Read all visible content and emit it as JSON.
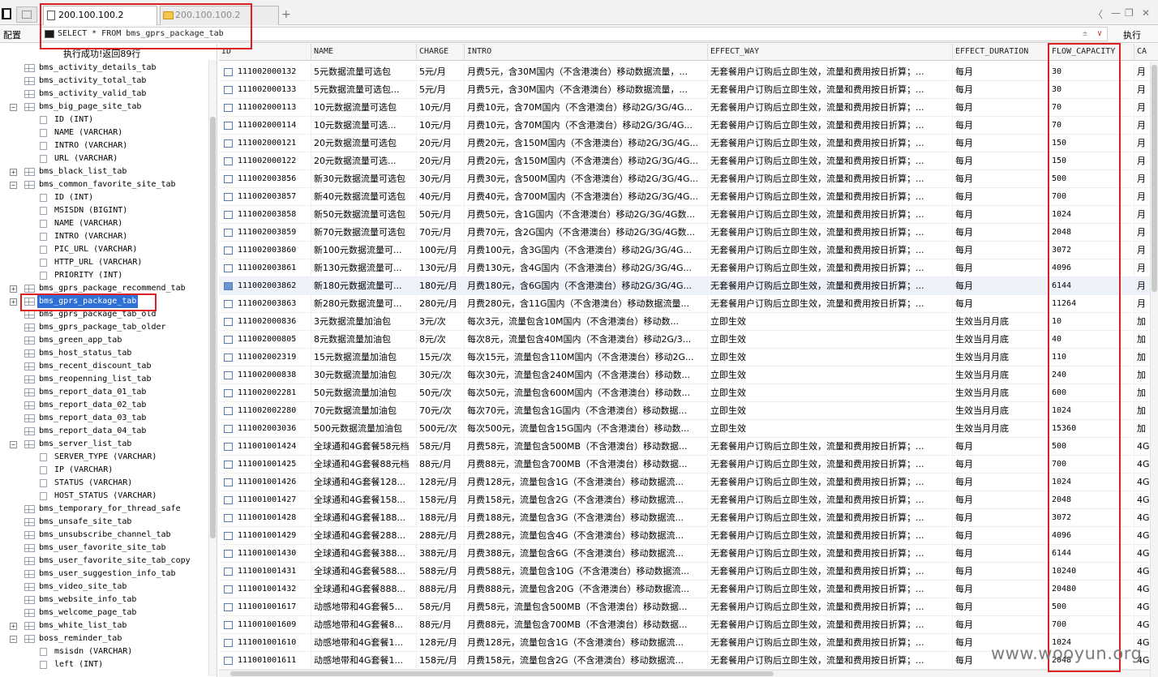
{
  "tabs": [
    {
      "label": "200.100.100.2",
      "active": true
    },
    {
      "label": "200.100.100.2",
      "active": false
    }
  ],
  "toolbar": {
    "config_label": "配置",
    "sql": "SELECT * FROM bms_gprs_package_tab",
    "execute_label": "执行",
    "sql_controls": [
      "±",
      "∨"
    ]
  },
  "window_controls": [
    "〈",
    "—",
    "❐",
    "✕"
  ],
  "plus_label": "+",
  "status_message": "执行成功!返回89行",
  "tree": [
    {
      "kind": "table",
      "label": "bms_activity_details_tab",
      "toggle": ""
    },
    {
      "kind": "table",
      "label": "bms_activity_total_tab",
      "toggle": ""
    },
    {
      "kind": "table",
      "label": "bms_activity_valid_tab",
      "toggle": ""
    },
    {
      "kind": "table",
      "label": "bms_big_page_site_tab",
      "toggle": "−"
    },
    {
      "kind": "column",
      "label": "ID (INT)"
    },
    {
      "kind": "column",
      "label": "NAME (VARCHAR)"
    },
    {
      "kind": "column",
      "label": "INTRO (VARCHAR)"
    },
    {
      "kind": "column",
      "label": "URL (VARCHAR)"
    },
    {
      "kind": "table",
      "label": "bms_black_list_tab",
      "toggle": "+"
    },
    {
      "kind": "table",
      "label": "bms_common_favorite_site_tab",
      "toggle": "−"
    },
    {
      "kind": "column",
      "label": "ID (INT)"
    },
    {
      "kind": "column",
      "label": "MSISDN (BIGINT)"
    },
    {
      "kind": "column",
      "label": "NAME (VARCHAR)"
    },
    {
      "kind": "column",
      "label": "INTRO (VARCHAR)"
    },
    {
      "kind": "column",
      "label": "PIC_URL (VARCHAR)"
    },
    {
      "kind": "column",
      "label": "HTTP_URL (VARCHAR)"
    },
    {
      "kind": "column",
      "label": "PRIORITY (INT)"
    },
    {
      "kind": "table",
      "label": "bms_gprs_package_recommend_tab",
      "toggle": "+"
    },
    {
      "kind": "table",
      "label": "bms_gprs_package_tab",
      "toggle": "+",
      "selected": true
    },
    {
      "kind": "table",
      "label": "bms_gprs_package_tab_old",
      "toggle": ""
    },
    {
      "kind": "table",
      "label": "bms_gprs_package_tab_older",
      "toggle": ""
    },
    {
      "kind": "table",
      "label": "bms_green_app_tab",
      "toggle": ""
    },
    {
      "kind": "table",
      "label": "bms_host_status_tab",
      "toggle": ""
    },
    {
      "kind": "table",
      "label": "bms_recent_discount_tab",
      "toggle": ""
    },
    {
      "kind": "table",
      "label": "bms_reopenning_list_tab",
      "toggle": ""
    },
    {
      "kind": "table",
      "label": "bms_report_data_01_tab",
      "toggle": ""
    },
    {
      "kind": "table",
      "label": "bms_report_data_02_tab",
      "toggle": ""
    },
    {
      "kind": "table",
      "label": "bms_report_data_03_tab",
      "toggle": ""
    },
    {
      "kind": "table",
      "label": "bms_report_data_04_tab",
      "toggle": ""
    },
    {
      "kind": "table",
      "label": "bms_server_list_tab",
      "toggle": "−"
    },
    {
      "kind": "column",
      "label": "SERVER_TYPE (VARCHAR)"
    },
    {
      "kind": "column",
      "label": "IP (VARCHAR)"
    },
    {
      "kind": "column",
      "label": "STATUS (VARCHAR)"
    },
    {
      "kind": "column",
      "label": "HOST_STATUS (VARCHAR)"
    },
    {
      "kind": "table",
      "label": "bms_temporary_for_thread_safe",
      "toggle": ""
    },
    {
      "kind": "table",
      "label": "bms_unsafe_site_tab",
      "toggle": ""
    },
    {
      "kind": "table",
      "label": "bms_unsubscribe_channel_tab",
      "toggle": ""
    },
    {
      "kind": "table",
      "label": "bms_user_favorite_site_tab",
      "toggle": ""
    },
    {
      "kind": "table",
      "label": "bms_user_favorite_site_tab_copy",
      "toggle": ""
    },
    {
      "kind": "table",
      "label": "bms_user_suggestion_info_tab",
      "toggle": ""
    },
    {
      "kind": "table",
      "label": "bms_video_site_tab",
      "toggle": ""
    },
    {
      "kind": "table",
      "label": "bms_website_info_tab",
      "toggle": ""
    },
    {
      "kind": "table",
      "label": "bms_welcome_page_tab",
      "toggle": ""
    },
    {
      "kind": "table",
      "label": "bms_white_list_tab",
      "toggle": "+"
    },
    {
      "kind": "table",
      "label": "boss_reminder_tab",
      "toggle": "−"
    },
    {
      "kind": "column",
      "label": "msisdn (VARCHAR)"
    },
    {
      "kind": "column",
      "label": "left (INT)"
    }
  ],
  "grid": {
    "columns": [
      "ID",
      "NAME",
      "CHARGE",
      "INTRO",
      "EFFECT_WAY",
      "EFFECT_DURATION",
      "FLOW_CAPACITY",
      "CA"
    ],
    "rows": [
      [
        "111002000132",
        "5元数据流量可选包",
        "5元/月",
        "月费5元，含30M国内（不含港澳台）移动数据流量，...",
        "无套餐用户订购后立即生效，流量和费用按日折算；...",
        "每月",
        "30",
        "月"
      ],
      [
        "111002000133",
        "5元数据流量可选包...",
        "5元/月",
        "月费5元，含30M国内（不含港澳台）移动数据流量，...",
        "无套餐用户订购后立即生效，流量和费用按日折算；...",
        "每月",
        "30",
        "月"
      ],
      [
        "111002000113",
        "10元数据流量可选包",
        "10元/月",
        "月费10元，含70M国内（不含港澳台）移动2G/3G/4G...",
        "无套餐用户订购后立即生效，流量和费用按日折算；...",
        "每月",
        "70",
        "月"
      ],
      [
        "111002000114",
        "10元数据流量可选...",
        "10元/月",
        "月费10元，含70M国内（不含港澳台）移动2G/3G/4G...",
        "无套餐用户订购后立即生效，流量和费用按日折算；...",
        "每月",
        "70",
        "月"
      ],
      [
        "111002000121",
        "20元数据流量可选包",
        "20元/月",
        "月费20元，含150M国内（不含港澳台）移动2G/3G/4G...",
        "无套餐用户订购后立即生效，流量和费用按日折算；...",
        "每月",
        "150",
        "月"
      ],
      [
        "111002000122",
        "20元数据流量可选...",
        "20元/月",
        "月费20元，含150M国内（不含港澳台）移动2G/3G/4G...",
        "无套餐用户订购后立即生效，流量和费用按日折算；...",
        "每月",
        "150",
        "月"
      ],
      [
        "111002003856",
        "新30元数据流量可选包",
        "30元/月",
        "月费30元，含500M国内（不含港澳台）移动2G/3G/4G...",
        "无套餐用户订购后立即生效，流量和费用按日折算；...",
        "每月",
        "500",
        "月"
      ],
      [
        "111002003857",
        "新40元数据流量可选包",
        "40元/月",
        "月费40元，含700M国内（不含港澳台）移动2G/3G/4G...",
        "无套餐用户订购后立即生效，流量和费用按日折算；...",
        "每月",
        "700",
        "月"
      ],
      [
        "111002003858",
        "新50元数据流量可选包",
        "50元/月",
        "月费50元，含1G国内（不含港澳台）移动2G/3G/4G数...",
        "无套餐用户订购后立即生效，流量和费用按日折算；...",
        "每月",
        "1024",
        "月"
      ],
      [
        "111002003859",
        "新70元数据流量可选包",
        "70元/月",
        "月费70元，含2G国内（不含港澳台）移动2G/3G/4G数...",
        "无套餐用户订购后立即生效，流量和费用按日折算；...",
        "每月",
        "2048",
        "月"
      ],
      [
        "111002003860",
        "新100元数据流量可...",
        "100元/月",
        "月费100元，含3G国内（不含港澳台）移动2G/3G/4G...",
        "无套餐用户订购后立即生效，流量和费用按日折算；...",
        "每月",
        "3072",
        "月"
      ],
      [
        "111002003861",
        "新130元数据流量可...",
        "130元/月",
        "月费130元，含4G国内（不含港澳台）移动2G/3G/4G...",
        "无套餐用户订购后立即生效，流量和费用按日折算；...",
        "每月",
        "4096",
        "月"
      ],
      [
        "111002003862",
        "新180元数据流量可...",
        "180元/月",
        "月费180元，含6G国内（不含港澳台）移动2G/3G/4G...",
        "无套餐用户订购后立即生效，流量和费用按日折算；...",
        "每月",
        "6144",
        "月"
      ],
      [
        "111002003863",
        "新280元数据流量可...",
        "280元/月",
        "月费280元，含11G国内（不含港澳台）移动数据流量...",
        "无套餐用户订购后立即生效，流量和费用按日折算；...",
        "每月",
        "11264",
        "月"
      ],
      [
        "111002000836",
        "3元数据流量加油包",
        "3元/次",
        "每次3元，流量包含10M国内（不含港澳台）移动数...",
        "立即生效",
        "生效当月月底",
        "10",
        "加"
      ],
      [
        "111002000805",
        "8元数据流量加油包",
        "8元/次",
        "每次8元，流量包含40M国内（不含港澳台）移动2G/3...",
        "立即生效",
        "生效当月月底",
        "40",
        "加"
      ],
      [
        "111002002319",
        "15元数据流量加油包",
        "15元/次",
        "每次15元，流量包含110M国内（不含港澳台）移动2G...",
        "立即生效",
        "生效当月月底",
        "110",
        "加"
      ],
      [
        "111002000838",
        "30元数据流量加油包",
        "30元/次",
        "每次30元，流量包含240M国内（不含港澳台）移动数...",
        "立即生效",
        "生效当月月底",
        "240",
        "加"
      ],
      [
        "111002002281",
        "50元数据流量加油包",
        "50元/次",
        "每次50元，流量包含600M国内（不含港澳台）移动数...",
        "立即生效",
        "生效当月月底",
        "600",
        "加"
      ],
      [
        "111002002280",
        "70元数据流量加油包",
        "70元/次",
        "每次70元，流量包含1G国内（不含港澳台）移动数据...",
        "立即生效",
        "生效当月月底",
        "1024",
        "加"
      ],
      [
        "111002003036",
        "500元数据流量加油包",
        "500元/次",
        "每次500元，流量包含15G国内（不含港澳台）移动数...",
        "立即生效",
        "生效当月月底",
        "15360",
        "加"
      ],
      [
        "111001001424",
        "全球通和4G套餐58元档",
        "58元/月",
        "月费58元，流量包含500MB（不含港澳台）移动数据...",
        "无套餐用户订购后立即生效，流量和费用按日折算；...",
        "每月",
        "500",
        "4G"
      ],
      [
        "111001001425",
        "全球通和4G套餐88元档",
        "88元/月",
        "月费88元，流量包含700MB（不含港澳台）移动数据...",
        "无套餐用户订购后立即生效，流量和费用按日折算；...",
        "每月",
        "700",
        "4G"
      ],
      [
        "111001001426",
        "全球通和4G套餐128...",
        "128元/月",
        "月费128元，流量包含1G（不含港澳台）移动数据流...",
        "无套餐用户订购后立即生效，流量和费用按日折算；...",
        "每月",
        "1024",
        "4G"
      ],
      [
        "111001001427",
        "全球通和4G套餐158...",
        "158元/月",
        "月费158元，流量包含2G（不含港澳台）移动数据流...",
        "无套餐用户订购后立即生效，流量和费用按日折算；...",
        "每月",
        "2048",
        "4G"
      ],
      [
        "111001001428",
        "全球通和4G套餐188...",
        "188元/月",
        "月费188元，流量包含3G（不含港澳台）移动数据流...",
        "无套餐用户订购后立即生效，流量和费用按日折算；...",
        "每月",
        "3072",
        "4G"
      ],
      [
        "111001001429",
        "全球通和4G套餐288...",
        "288元/月",
        "月费288元，流量包含4G（不含港澳台）移动数据流...",
        "无套餐用户订购后立即生效，流量和费用按日折算；...",
        "每月",
        "4096",
        "4G"
      ],
      [
        "111001001430",
        "全球通和4G套餐388...",
        "388元/月",
        "月费388元，流量包含6G（不含港澳台）移动数据流...",
        "无套餐用户订购后立即生效，流量和费用按日折算；...",
        "每月",
        "6144",
        "4G"
      ],
      [
        "111001001431",
        "全球通和4G套餐588...",
        "588元/月",
        "月费588元，流量包含10G（不含港澳台）移动数据流...",
        "无套餐用户订购后立即生效，流量和费用按日折算；...",
        "每月",
        "10240",
        "4G"
      ],
      [
        "111001001432",
        "全球通和4G套餐888...",
        "888元/月",
        "月费888元，流量包含20G（不含港澳台）移动数据流...",
        "无套餐用户订购后立即生效，流量和费用按日折算；...",
        "每月",
        "20480",
        "4G"
      ],
      [
        "111001001617",
        "动感地带和4G套餐5...",
        "58元/月",
        "月费58元，流量包含500MB（不含港澳台）移动数据...",
        "无套餐用户订购后立即生效，流量和费用按日折算；...",
        "每月",
        "500",
        "4G"
      ],
      [
        "111001001609",
        "动感地带和4G套餐8...",
        "88元/月",
        "月费88元，流量包含700MB（不含港澳台）移动数据...",
        "无套餐用户订购后立即生效，流量和费用按日折算；...",
        "每月",
        "700",
        "4G"
      ],
      [
        "111001001610",
        "动感地带和4G套餐1...",
        "128元/月",
        "月费128元，流量包含1G（不含港澳台）移动数据流...",
        "无套餐用户订购后立即生效，流量和费用按日折算；...",
        "每月",
        "1024",
        "4G"
      ],
      [
        "111001001611",
        "动感地带和4G套餐1...",
        "158元/月",
        "月费158元，流量包含2G（不含港澳台）移动数据流...",
        "无套餐用户订购后立即生效，流量和费用按日折算；...",
        "每月",
        "2048",
        "4G"
      ]
    ],
    "selected_row": 12
  },
  "watermark": "www.wooyun.org",
  "colors": {
    "highlight": "#e02020",
    "selection": "#2e70d6"
  }
}
